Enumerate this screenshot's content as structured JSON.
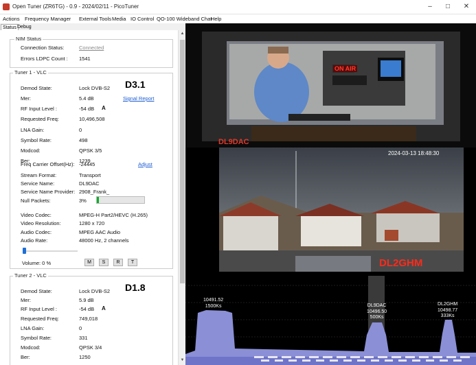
{
  "window": {
    "title": "Open Tuner  (ZR6TG) - 0.9 - 2024/02/11 - PicoTuner",
    "minimize": "–",
    "maximize": "□",
    "close": "✕"
  },
  "menu": [
    "Actions",
    "Frequency Manager",
    "External Tools",
    "Media",
    "IO Control",
    "QO-100 Wideband Chat",
    "Help"
  ],
  "tabs": [
    "Status",
    "Debug"
  ],
  "nim": {
    "title": "NIM Status",
    "connection_label": "Connection Status:",
    "connection_value": "Connected",
    "errors_label": "Errors LDPC Count :",
    "errors_value": "1541"
  },
  "tuner1": {
    "title": "Tuner 1 - VLC",
    "badge": "D3.1",
    "signal_report": "Signal Report",
    "adjust": "Adjust",
    "rf_flag": "A",
    "rows": [
      {
        "label": "Demod State:",
        "value": "Lock DVB-S2"
      },
      {
        "label": "Mer:",
        "value": "5.4 dB"
      },
      {
        "label": "RF Input Level :",
        "value": "-54 dB"
      },
      {
        "label": "Requested Freq:",
        "value": "10,496,508"
      },
      {
        "label": "LNA Gain:",
        "value": "0"
      },
      {
        "label": "Symbol Rate:",
        "value": "498"
      },
      {
        "label": "Modcod:",
        "value": "QPSK 3/5"
      },
      {
        "label": "Ber:",
        "value": "1239"
      },
      {
        "label": "Freq Carrier Offset(Hz):",
        "value": "-24445"
      },
      {
        "label": "Stream Format:",
        "value": "Transport"
      },
      {
        "label": "Service Name:",
        "value": "DL9DAC"
      },
      {
        "label": "Service Name Provider:",
        "value": "2908_Frank_"
      },
      {
        "label": "Null Packets:",
        "value": "3%"
      },
      {
        "label": "Video Codec:",
        "value": "MPEG-H Part2/HEVC (H.265)"
      },
      {
        "label": "Video Resolution:",
        "value": "1280 x 720"
      },
      {
        "label": "Audio Codec:",
        "value": "MPEG AAC Audio"
      },
      {
        "label": "Audio Rate:",
        "value": "48000 Hz, 2 channels"
      }
    ],
    "null_packets_level": 0.03,
    "volume_label": "Volume: 0 %",
    "volume_level": 0.0,
    "buttons": [
      "M",
      "S",
      "R",
      "T"
    ]
  },
  "tuner2": {
    "title": "Tuner 2 - VLC",
    "badge": "D1.8",
    "rf_flag": "A",
    "rows": [
      {
        "label": "Demod State:",
        "value": "Lock DVB-S2"
      },
      {
        "label": "Mer:",
        "value": "5.9 dB"
      },
      {
        "label": "RF Input Level :",
        "value": "-54 dB"
      },
      {
        "label": "Requested Freq:",
        "value": "749,018"
      },
      {
        "label": "LNA Gain:",
        "value": "0"
      },
      {
        "label": "Symbol Rate:",
        "value": "331"
      },
      {
        "label": "Modcod:",
        "value": "QPSK 3/4"
      },
      {
        "label": "Ber:",
        "value": "1250"
      }
    ]
  },
  "video1": {
    "callsign": "DL9DAC",
    "sign": "ON AIR"
  },
  "video2": {
    "timestamp": "2024-03-13  18:48:30",
    "callsign": "DL2GHM"
  },
  "spectrum": {
    "signals": [
      {
        "freq": "10491.52",
        "rate": "1500Ks"
      },
      {
        "callsign": "DL9DAC",
        "freq": "10496.50",
        "rate": "500Ks"
      },
      {
        "callsign": "DL2GHM",
        "freq": "10498.77",
        "rate": "333Ks"
      }
    ]
  },
  "colors": {
    "accent": "#1a5bd0",
    "overlay_callsign": "#e0392b",
    "spectrum_fill": "#8a8fd6",
    "progress": "#06b025"
  }
}
